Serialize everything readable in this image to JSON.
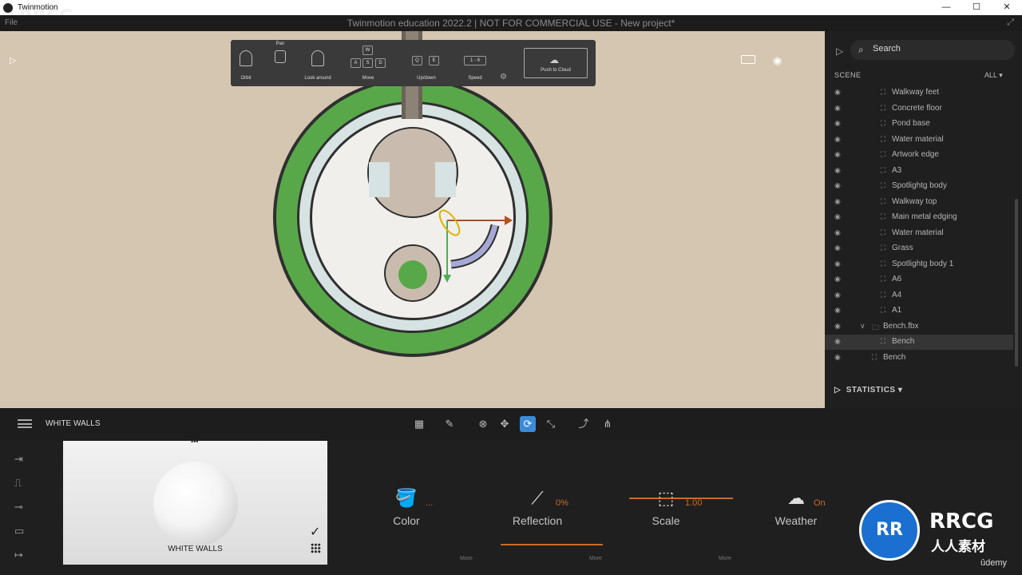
{
  "os": {
    "app_title": "Twinmotion",
    "controls": [
      "—",
      "☐",
      "✕"
    ]
  },
  "header": {
    "menu": [
      "File"
    ],
    "title": "Twinmotion education 2022.2 | NOT FOR COMMERCIAL USE - New project*"
  },
  "nav": {
    "orbit": "Orbit",
    "pan": "Pan",
    "look_around": "Look around",
    "move": "Move",
    "up_down": "Up/down",
    "speed": "Speed",
    "speed_value": "1 - 6",
    "push_to_cloud": "Push to Cloud",
    "keys": {
      "w": "W",
      "a": "A",
      "s": "S",
      "d": "D",
      "q": "Q",
      "e": "E"
    }
  },
  "scene": {
    "search_placeholder": "Search",
    "label": "SCENE",
    "filter": "ALL",
    "items": [
      {
        "name": "Walkway feet",
        "indent": 2
      },
      {
        "name": "Concrete floor",
        "indent": 2
      },
      {
        "name": "Pond base",
        "indent": 2
      },
      {
        "name": "Water material",
        "indent": 2
      },
      {
        "name": "Artwork edge",
        "indent": 2
      },
      {
        "name": "A3",
        "indent": 2
      },
      {
        "name": "Spotlightg body",
        "indent": 2
      },
      {
        "name": "Walkway top",
        "indent": 2
      },
      {
        "name": "Main metal edging",
        "indent": 2
      },
      {
        "name": "Water material",
        "indent": 2
      },
      {
        "name": "Grass",
        "indent": 2
      },
      {
        "name": "Spotlightg body 1",
        "indent": 2
      },
      {
        "name": "A6",
        "indent": 2
      },
      {
        "name": "A4",
        "indent": 2
      },
      {
        "name": "A1",
        "indent": 2
      },
      {
        "name": "Bench.fbx",
        "indent": 1
      },
      {
        "name": "Bench",
        "indent": 2
      },
      {
        "name": "Bench",
        "indent": 1
      }
    ],
    "statistics": "STATISTICS"
  },
  "material": {
    "name": "WHITE WALLS",
    "card_label": "WHITE WALLS"
  },
  "props": {
    "color": {
      "label": "Color",
      "value": "..."
    },
    "reflection": {
      "label": "Reflection",
      "value": "0%"
    },
    "scale": {
      "label": "Scale",
      "value": "1.00"
    },
    "weather": {
      "label": "Weather",
      "value": "On"
    },
    "more": "More"
  },
  "watermark": {
    "top": "RRCG",
    "badge": "RR",
    "brand": "RRCG",
    "brand_sub": "人人素材",
    "udemy": "ûdemy"
  },
  "colors": {
    "viewport_bg": "#d5c6b1",
    "grass": "#58a84a",
    "accent": "#c86a2e",
    "active_tool": "#3b8bd9"
  }
}
